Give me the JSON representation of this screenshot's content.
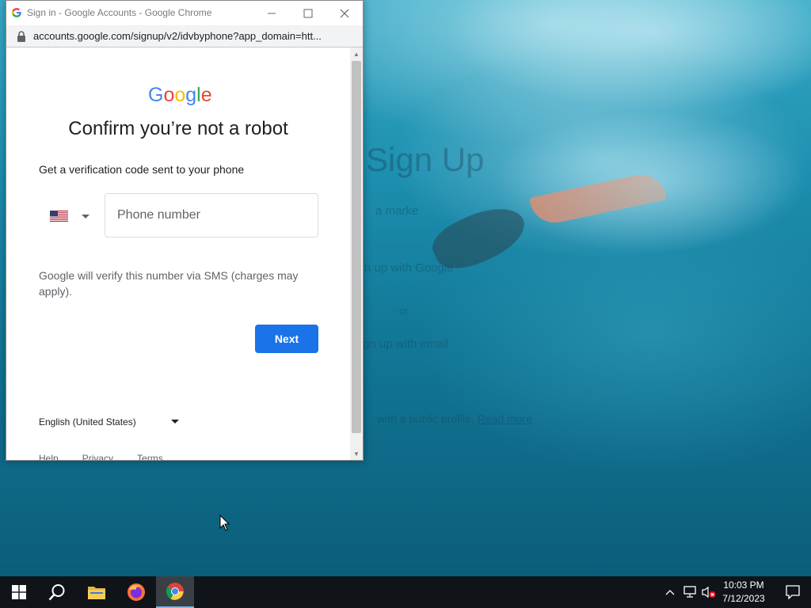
{
  "window": {
    "title": "Sign in - Google Accounts - Google Chrome",
    "url": "accounts.google.com/signup/v2/idvbyphone?app_domain=htt..."
  },
  "page": {
    "logo": {
      "letters": [
        "G",
        "o",
        "o",
        "g",
        "l",
        "e"
      ],
      "colors": [
        "#4285f4",
        "#ea4335",
        "#fbbc05",
        "#4285f4",
        "#34a853",
        "#ea4335"
      ]
    },
    "heading": "Confirm you’re not a robot",
    "subtext": "Get a verification code sent to your phone",
    "country": {
      "flag": "us-flag-icon"
    },
    "phone": {
      "placeholder": "Phone number",
      "value": ""
    },
    "help_text": "Google will verify this number via SMS (charges may apply).",
    "next_label": "Next",
    "language": "English (United States)",
    "footer": {
      "help": "Help",
      "privacy": "Privacy",
      "terms": "Terms"
    },
    "accent": "#1a73e8"
  },
  "background_page": {
    "title": "Sign Up",
    "subtitle": "a marke",
    "google": "n up with Google",
    "or": "or",
    "email": "gn up with email",
    "public": "with a public profile.",
    "read_more": "Read more"
  },
  "taskbar": {
    "time": "10:03 PM",
    "date": "7/12/2023",
    "pinned": [
      "windows-start-icon",
      "search-icon",
      "file-explorer-icon",
      "firefox-icon",
      "chrome-icon"
    ]
  }
}
